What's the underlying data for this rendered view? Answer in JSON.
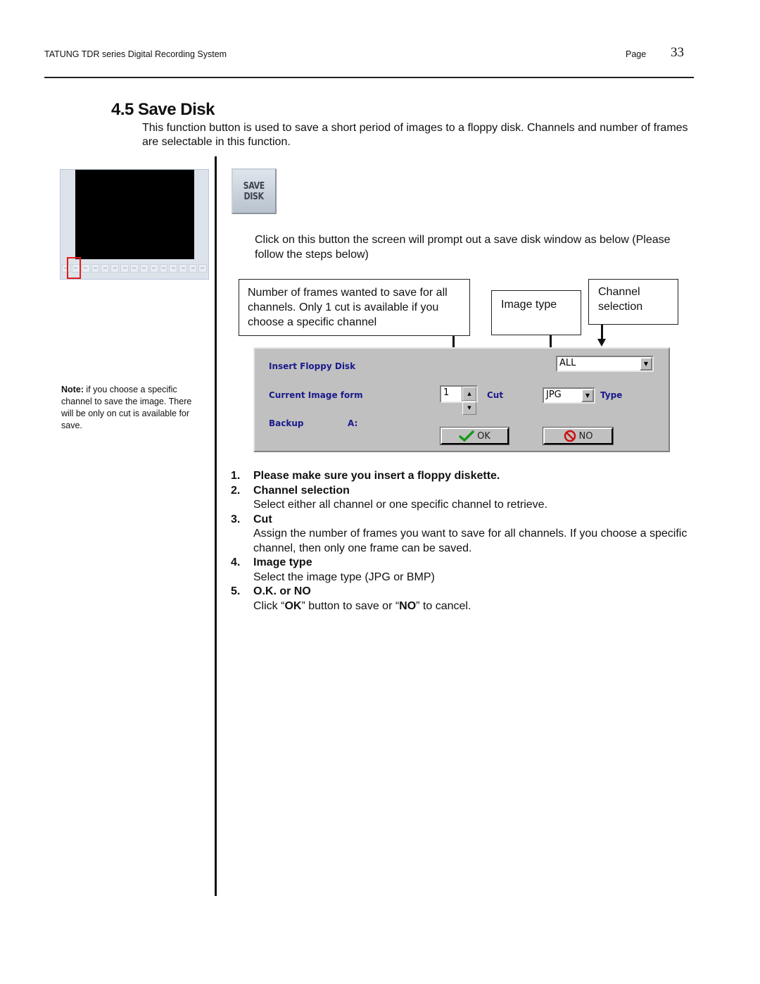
{
  "header": {
    "doc_title": "TATUNG TDR series Digital Recording System",
    "page_label": "Page",
    "page_number": "33"
  },
  "section": {
    "title": "4.5 Save Disk",
    "intro": "This function button is used to save a short period of images to a floppy disk. Channels and number of frames are selectable in this function."
  },
  "sidebar": {
    "note_label": "Note:",
    "note_text": " if you choose a specific channel to save the image. There will be only on cut is available for save."
  },
  "save_disk_button": {
    "line1": "SAVE",
    "line2": "DISK"
  },
  "click_text": "Click on this button the screen will prompt out a save disk window as below (Please follow the steps below)",
  "callouts": {
    "frames": "Number of frames wanted to save for all channels. Only 1 cut is available if you choose a specific channel",
    "image_type": "Image type",
    "channel": "Channel selection"
  },
  "dialog": {
    "insert_label": "Insert Floppy Disk",
    "current_label": "Current Image form",
    "backup_label": "Backup",
    "backup_drive": "A:",
    "channel_value": "ALL",
    "cut_value": "1",
    "cut_label": "Cut",
    "type_value": "JPG",
    "type_label": "Type",
    "ok_label": "OK",
    "no_label": "NO",
    "colors": {
      "label": "#1a1a8c",
      "face": "#c0c0c0",
      "ok_check": "#1a9a1a",
      "no_icon": "#cc1111"
    }
  },
  "steps": [
    {
      "num": "1.",
      "title": "Please make sure you insert a floppy diskette.",
      "desc": ""
    },
    {
      "num": "2.",
      "title": "Channel selection",
      "desc": "Select either all channel or one specific channel to retrieve."
    },
    {
      "num": "3.",
      "title": "Cut",
      "desc": "Assign the number of frames you want to save for all channels. If you choose a specific channel, then only one frame can be saved."
    },
    {
      "num": "4.",
      "title": "Image type",
      "desc": "Select the image type (JPG or BMP)"
    },
    {
      "num": "5.",
      "title": "O.K. or NO",
      "desc_pre": "Click “",
      "desc_ok": "OK",
      "desc_mid": "” button to save or “",
      "desc_no": "NO",
      "desc_post": "” to cancel."
    }
  ]
}
